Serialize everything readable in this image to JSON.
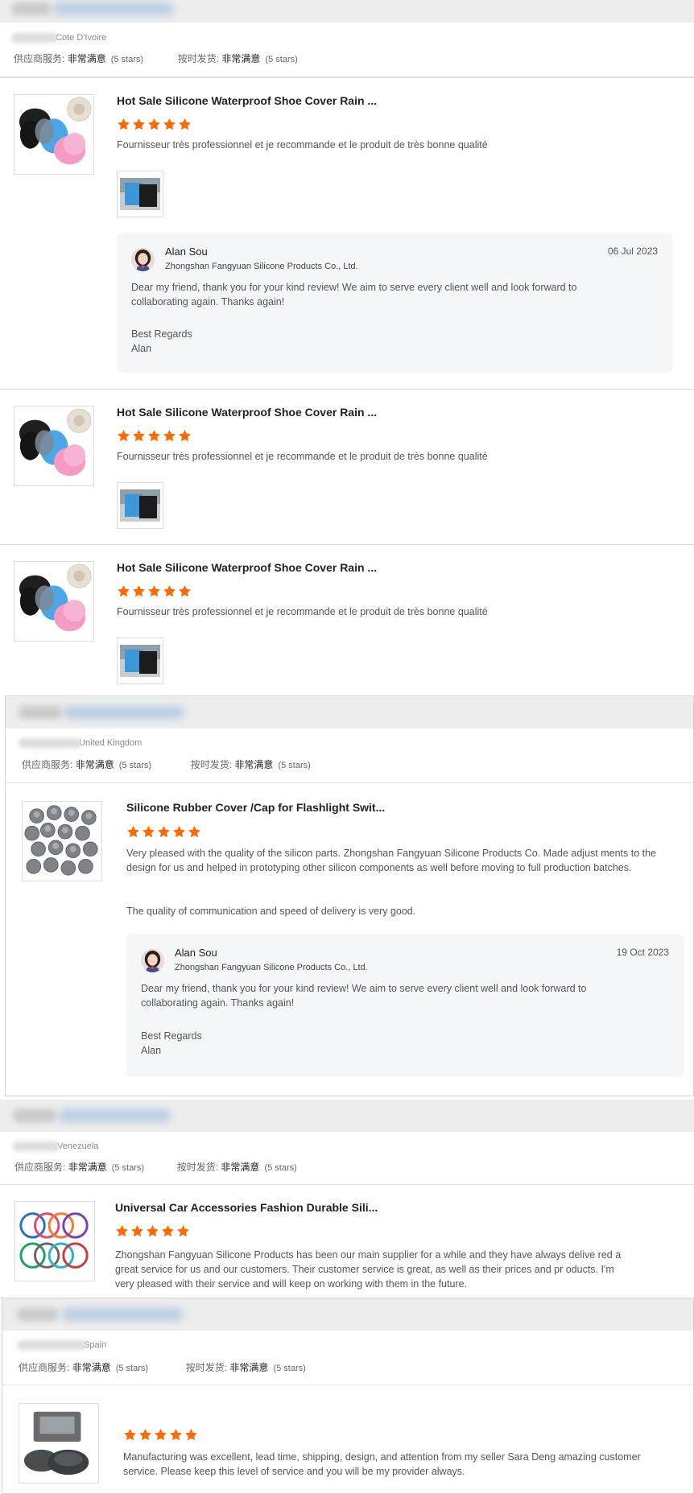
{
  "reviews": [
    {
      "buyer_location": "Cote D'Ivoire",
      "supplier_service": {
        "label": "供应商服务:",
        "value": "非常满意",
        "stars": "(5 stars)"
      },
      "shipment": {
        "label": "按时发货:",
        "value": "非常满意",
        "stars": "(5 stars)"
      },
      "items": [
        {
          "product_title": "Hot Sale Silicone Waterproof Shoe Cover Rain ...",
          "rating": 5,
          "text": "Fournisseur très professionnel et je recommande et le produit  de très bonne qualité",
          "reply": {
            "name": "Alan Sou",
            "company": "Zhongshan Fangyuan Silicone Products Co., Ltd.",
            "date": "06 Jul 2023",
            "body": "Dear my friend, thank you for your kind review! We aim to serve every client well and look forward to collaborating again. Thanks again!",
            "sign1": "Best Regards",
            "sign2": "Alan"
          }
        },
        {
          "product_title": "Hot Sale Silicone Waterproof Shoe Cover Rain ...",
          "rating": 5,
          "text": "Fournisseur très professionnel et je recommande et le produit  de très bonne qualité"
        },
        {
          "product_title": "Hot Sale Silicone Waterproof Shoe Cover Rain ...",
          "rating": 5,
          "text": "Fournisseur très professionnel et je recommande et le produit  de très bonne qualité"
        }
      ]
    },
    {
      "buyer_location": "United Kingdom",
      "supplier_service": {
        "label": "供应商服务:",
        "value": "非常满意",
        "stars": "(5 stars)"
      },
      "shipment": {
        "label": "按时发货:",
        "value": "非常满意",
        "stars": "(5 stars)"
      },
      "items": [
        {
          "product_title": "Silicone Rubber Cover /Cap for Flashlight Swit...",
          "rating": 5,
          "text": "Very pleased with the quality of the silicon parts. Zhongshan Fangyuan Silicone Products Co. Made adjust ments to the design for us and helped in prototyping other silicon components as well before moving to full production batches.",
          "text2": "The quality of communication and speed of delivery is very good.",
          "reply": {
            "name": "Alan Sou",
            "company": "Zhongshan Fangyuan Silicone Products Co., Ltd.",
            "date": "19 Oct 2023",
            "body": "Dear my friend, thank you for your kind review! We aim to serve every client well and look forward to collaborating again. Thanks again!",
            "sign1": "Best Regards",
            "sign2": "Alan"
          }
        }
      ]
    },
    {
      "buyer_location": "Venezuela",
      "supplier_service": {
        "label": "供应商服务:",
        "value": "非常满意",
        "stars": "(5 stars)"
      },
      "shipment": {
        "label": "按时发货:",
        "value": "非常满意",
        "stars": "(5 stars)"
      },
      "items": [
        {
          "product_title": "Universal Car Accessories Fashion Durable Sili...",
          "rating": 5,
          "text": "Zhongshan Fangyuan Silicone Products has been our main supplier for a while and they have always delive red a great service for us and our customers. Their customer service is great, as well as their prices and pr oducts. I'm very pleased with their service and will keep on working with them in the future."
        }
      ]
    },
    {
      "buyer_location": "Spain",
      "supplier_service": {
        "label": "供应商服务:",
        "value": "非常满意",
        "stars": "(5 stars)"
      },
      "shipment": {
        "label": "按时发货:",
        "value": "非常满意",
        "stars": "(5 stars)"
      },
      "items": [
        {
          "product_title": "",
          "rating": 5,
          "text": "Manufacturing was excellent, lead time, shipping, design, and attention from my seller Sara Deng amazing customer service. Please keep this level of service and you will be my provider always."
        }
      ]
    }
  ],
  "colors": {
    "star": "#ff6a00",
    "header_bg": "#ededed",
    "reply_bg": "#f5f6f8"
  }
}
